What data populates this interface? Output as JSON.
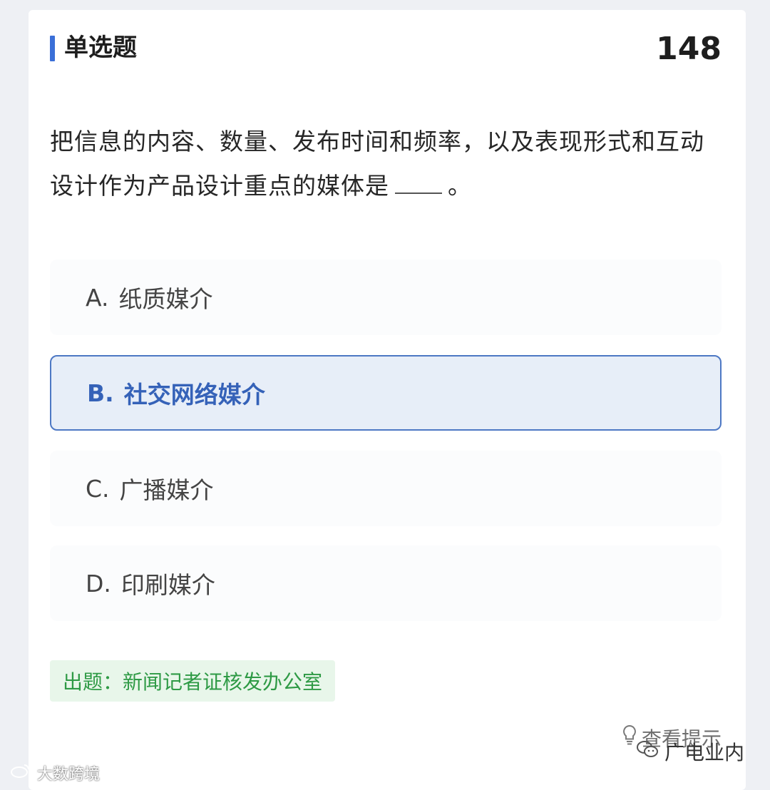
{
  "header": {
    "question_type": "单选题",
    "question_number": "148"
  },
  "question": {
    "text": "把信息的内容、数量、发布时间和频率，以及表现形式和互动设计作为产品设计重点的媒体是",
    "end_punct": "。"
  },
  "options": [
    {
      "letter": "A.",
      "label": "纸质媒介",
      "selected": false
    },
    {
      "letter": "B.",
      "label": "社交网络媒介",
      "selected": true
    },
    {
      "letter": "C.",
      "label": "广播媒介",
      "selected": false
    },
    {
      "letter": "D.",
      "label": "印刷媒介",
      "selected": false
    }
  ],
  "source": "出题：新闻记者证核发办公室",
  "hint_label": "查看提示",
  "watermarks": {
    "left": "大数跨境",
    "right": "广电业内"
  },
  "colors": {
    "accent": "#3a6fd8",
    "selected_border": "#4d78c4",
    "source_green": "#2e9a45"
  }
}
